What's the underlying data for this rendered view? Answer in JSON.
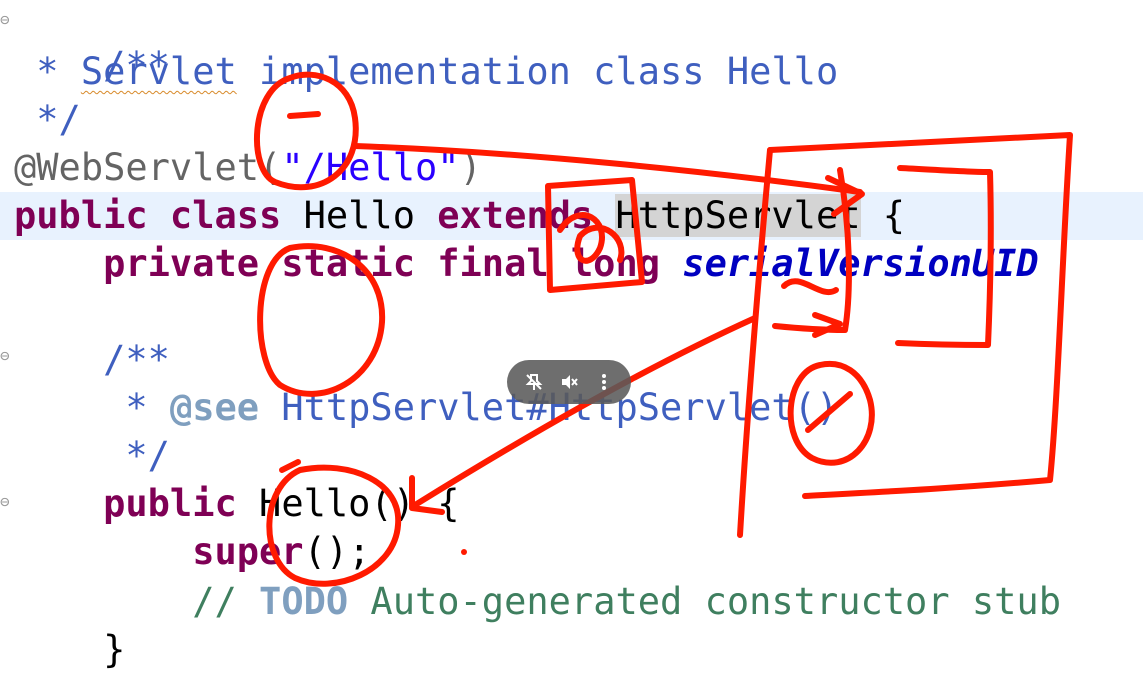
{
  "code": {
    "l1": "/**",
    "l2_star": " * ",
    "l2_servlet": "Servlet",
    "l2_rest": " implementation class Hello",
    "l3": " */",
    "l4_ann": "@WebServlet(",
    "l4_str": "\"/Hello\"",
    "l4_close": ")",
    "l5_kw1": "public class",
    "l5_name": " Hello ",
    "l5_kw2": "extends",
    "l5_sp": " ",
    "l5_super": "HttpServlet",
    "l5_brace": " {",
    "l6_kw": "    private static final long",
    "l6_sp": " ",
    "l6_field": "serialVersionUID",
    "l8": "    /**",
    "l9_star": "     * ",
    "l9_tag": "@see",
    "l9_ref": " HttpServlet#HttpServlet()",
    "l10": "     */",
    "l11_kw": "    public",
    "l11_rest": " Hello() {",
    "l12_kw": "        super",
    "l12_rest": "();",
    "l13_pre": "        // ",
    "l13_todo": "TODO",
    "l13_rest": " Auto-generated constructor stub",
    "l14": "    }"
  },
  "fold_markers": [
    "⊖",
    "⊖",
    "⊖"
  ],
  "overlay": {
    "icons": [
      "unpin-icon",
      "mute-icon",
      "more-vert-icon"
    ],
    "glyphs": [
      "✕",
      "🔇",
      "⋮"
    ]
  },
  "colors": {
    "keyword": "#7f0055",
    "comment": "#3f5fbf",
    "line_comment": "#3f7f5f",
    "string": "#2a00ff",
    "annotation_ink": "#ff1a00",
    "current_line": "#e8f2fe"
  }
}
